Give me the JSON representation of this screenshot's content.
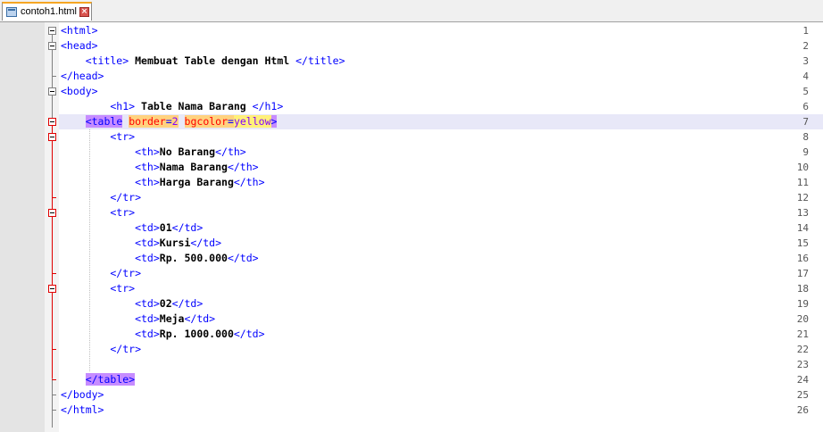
{
  "tab": {
    "filename": "contoh1.html",
    "file_icon": "html-file-icon",
    "close_icon": "close-icon"
  },
  "line_numbers": [
    "1",
    "2",
    "3",
    "4",
    "5",
    "6",
    "7",
    "8",
    "9",
    "10",
    "11",
    "12",
    "13",
    "14",
    "15",
    "16",
    "17",
    "18",
    "19",
    "20",
    "21",
    "22",
    "23",
    "24",
    "25",
    "26"
  ],
  "code": {
    "l1": "<html>",
    "l2": "<head>",
    "l3_open": "    <title>",
    "l3_text": " Membuat Table dengan Html ",
    "l3_close": "</title>",
    "l4": "</head>",
    "l5": "<body>",
    "l6_open": "        <h1>",
    "l6_text": " Table Nama Barang ",
    "l6_close": "</h1>",
    "l7_indent": "    ",
    "l7_tag": "<table",
    "l7_attr1": "border",
    "l7_eq1": "=",
    "l7_val1": "2",
    "l7_attr2": "bgcolor",
    "l7_eq2": "=",
    "l7_val2": "yellow",
    "l7_close": ">",
    "l8": "        <tr>",
    "l9_open": "            <th>",
    "l9_text": "No Barang",
    "l9_close": "</th>",
    "l10_open": "            <th>",
    "l10_text": "Nama Barang",
    "l10_close": "</th>",
    "l11_open": "            <th>",
    "l11_text": "Harga Barang",
    "l11_close": "</th>",
    "l12": "        </tr>",
    "l13": "        <tr>",
    "l14_open": "            <td>",
    "l14_text": "01",
    "l14_close": "</td>",
    "l15_open": "            <td>",
    "l15_text": "Kursi",
    "l15_close": "</td>",
    "l16_open": "            <td>",
    "l16_text": "Rp. 500.000",
    "l16_close": "</td>",
    "l17": "        </tr>",
    "l18": "        <tr>",
    "l19_open": "            <td>",
    "l19_text": "02",
    "l19_close": "</td>",
    "l20_open": "            <td>",
    "l20_text": "Meja",
    "l20_close": "</td>",
    "l21_open": "            <td>",
    "l21_text": "Rp. 1000.000",
    "l21_close": "</td>",
    "l22": "        </tr>",
    "l23": "",
    "l24_indent": "    ",
    "l24_tag": "</table>",
    "l25": "</body>",
    "l26": "</html>"
  },
  "colors": {
    "tag": "#0000ff",
    "attribute": "#ff0000",
    "value": "#8000ff",
    "current_line": "#e8e8f8",
    "fold_marker_active": "#e00000"
  }
}
